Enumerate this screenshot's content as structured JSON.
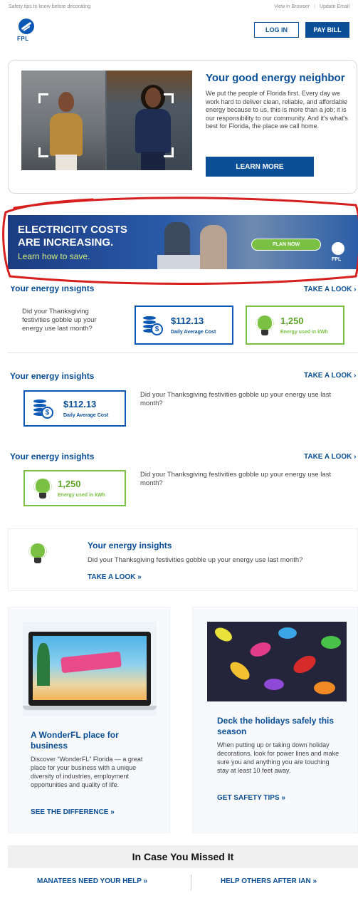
{
  "preheader": "Safety tips to know before decorating",
  "top_links": {
    "view_browser": "View in Browser",
    "separator": "|",
    "update_email": "Update Email"
  },
  "logo_text": "FPL",
  "header": {
    "login": "LOG IN",
    "pay_bill": "PAY BILL"
  },
  "hero": {
    "title": "Your good energy neighbor",
    "text": "We put the people of Florida first. Every day we work hard to deliver clean, reliable, and affordable energy because to us, this is more than a job; it is our responsibility to our community. And it's what's best for Florida, the place we call home.",
    "button": "LEARN MORE"
  },
  "banner": {
    "line1": "ELECTRICITY COSTS",
    "line2": "ARE INCREASING.",
    "line3": "Learn how to save.",
    "button": "PLAN NOW",
    "logo": "FPL"
  },
  "insights": {
    "title": "Your energy insights",
    "take_look": "TAKE A LOOK ›",
    "take_look_inline": "TAKE A LOOK »",
    "question": "Did your Thanksgiving festivities gobble up your energy use last month?",
    "cost_value": "$112.13",
    "cost_label": "Daily Average Cost",
    "kwh_value": "1,250",
    "kwh_label": "Energy used in kWh",
    "dollar_symbol": "$"
  },
  "features": [
    {
      "title": "A WonderFL place for business",
      "text": "Discover “WonderFL” Florida — a great place for your business with a unique diversity of industries, employment opportunities and quality of life.",
      "link": "SEE THE DIFFERENCE »"
    },
    {
      "title": "Deck the holidays safely this season",
      "text": "When putting up or taking down holiday decorations, look for power lines and make sure you and anything you are touching stay at least 10 feet away.",
      "link": "GET SAFETY TIPS »"
    }
  ],
  "icymi": {
    "title": "In Case You Missed It",
    "link1": "MANATEES NEED YOUR HELP »",
    "link2": "HELP OTHERS AFTER IAN »"
  },
  "colors": {
    "fpl_blue": "#0a4f98",
    "green": "#7ac143",
    "annotation_red": "#d61f1f"
  }
}
